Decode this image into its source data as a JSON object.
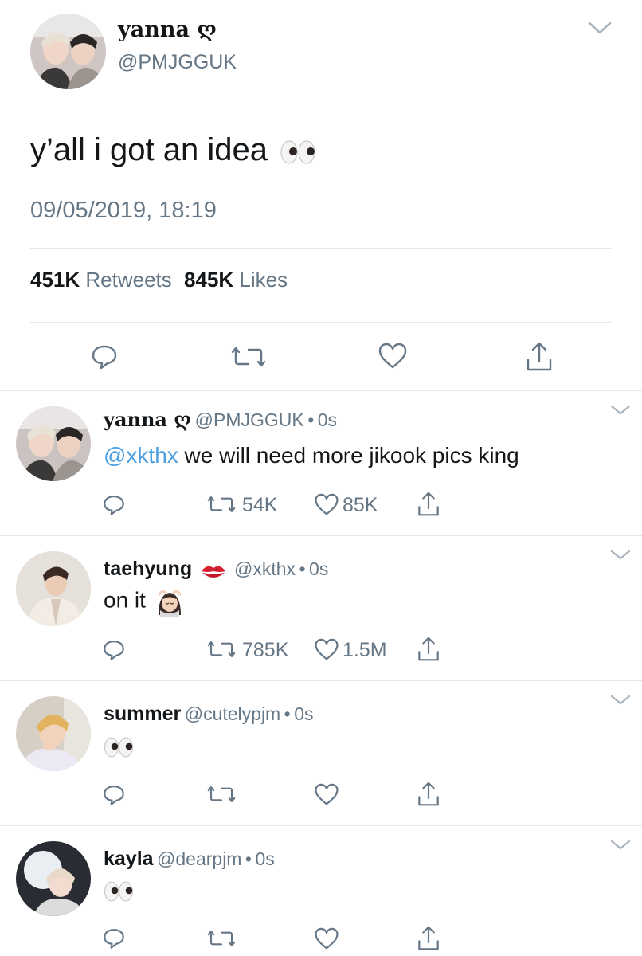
{
  "main_tweet": {
    "name": "yanna",
    "name_symbol": "ღ",
    "handle": "@PMJGGUK",
    "text": "y’all i got an idea",
    "text_emoji": "eyes-emoji",
    "timestamp": "09/05/2019, 18:19",
    "retweets_count": "451K",
    "retweets_label": "Retweets",
    "likes_count": "845K",
    "likes_label": "Likes"
  },
  "replies": [
    {
      "name": "yanna ღ",
      "handle": "@PMJGGUK",
      "sep": "•",
      "time": "0s",
      "mention": "@xkthx",
      "text": " we will need more jikook pics king",
      "retweets": "54K",
      "likes": "85K"
    },
    {
      "name": "taehyung",
      "name_emoji": "kiss-mark-emoji",
      "handle": "@xkthx",
      "sep": "•",
      "time": "0s",
      "text": "on it",
      "text_emoji": "woman-getting-massage-emoji",
      "retweets": "785K",
      "likes": "1.5M"
    },
    {
      "name": "summer",
      "handle": "@cutelypjm",
      "sep": "•",
      "time": "0s",
      "text_emoji": "eyes-emoji"
    },
    {
      "name": "kayla",
      "handle": "@dearpjm",
      "sep": "•",
      "time": "0s",
      "text_emoji": "eyes-emoji"
    }
  ],
  "colors": {
    "text": "#14171a",
    "secondary": "#657786",
    "link": "#4a9fe0",
    "divider": "#e1e8ed"
  }
}
